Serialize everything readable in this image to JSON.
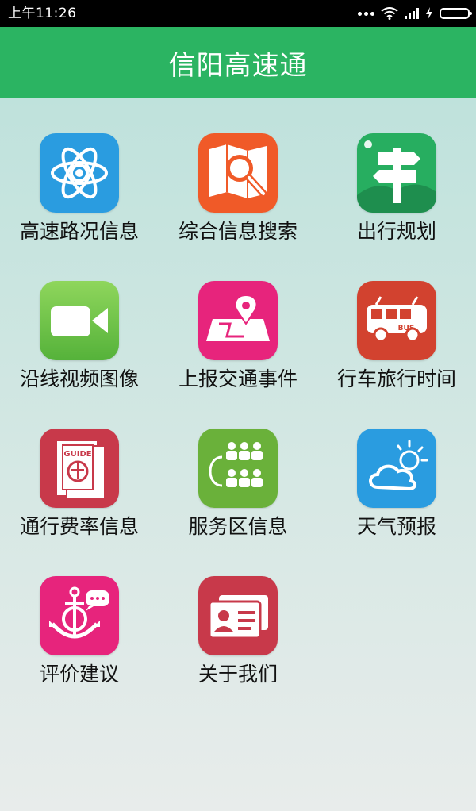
{
  "status_bar": {
    "time": "上午11:26",
    "icons": [
      "more-dots-icon",
      "wifi-icon",
      "signal-icon",
      "charging-icon",
      "battery-icon"
    ]
  },
  "app": {
    "title": "信阳高速通",
    "header_color": "#2bb462"
  },
  "menu": {
    "items": [
      {
        "label": "高速路况信息",
        "icon": "atom-icon",
        "color": "#2a9ce0"
      },
      {
        "label": "综合信息搜索",
        "icon": "map-search-icon",
        "color": "#f05a28"
      },
      {
        "label": "出行规划",
        "icon": "signpost-icon",
        "color": "#27ae60"
      },
      {
        "label": "沿线视频图像",
        "icon": "video-camera-icon",
        "color": "#6cc04a"
      },
      {
        "label": "上报交通事件",
        "icon": "map-pin-icon",
        "color": "#e7247c"
      },
      {
        "label": "行车旅行时间",
        "icon": "bus-icon",
        "color": "#d2422f"
      },
      {
        "label": "通行费率信息",
        "icon": "guide-book-icon",
        "color": "#c8394a"
      },
      {
        "label": "服务区信息",
        "icon": "service-area-icon",
        "color": "#6ab13a"
      },
      {
        "label": "天气预报",
        "icon": "weather-icon",
        "color": "#2a9ce0"
      },
      {
        "label": "评价建议",
        "icon": "anchor-chat-icon",
        "color": "#e7247c"
      },
      {
        "label": "关于我们",
        "icon": "id-card-icon",
        "color": "#c8394a"
      }
    ]
  }
}
